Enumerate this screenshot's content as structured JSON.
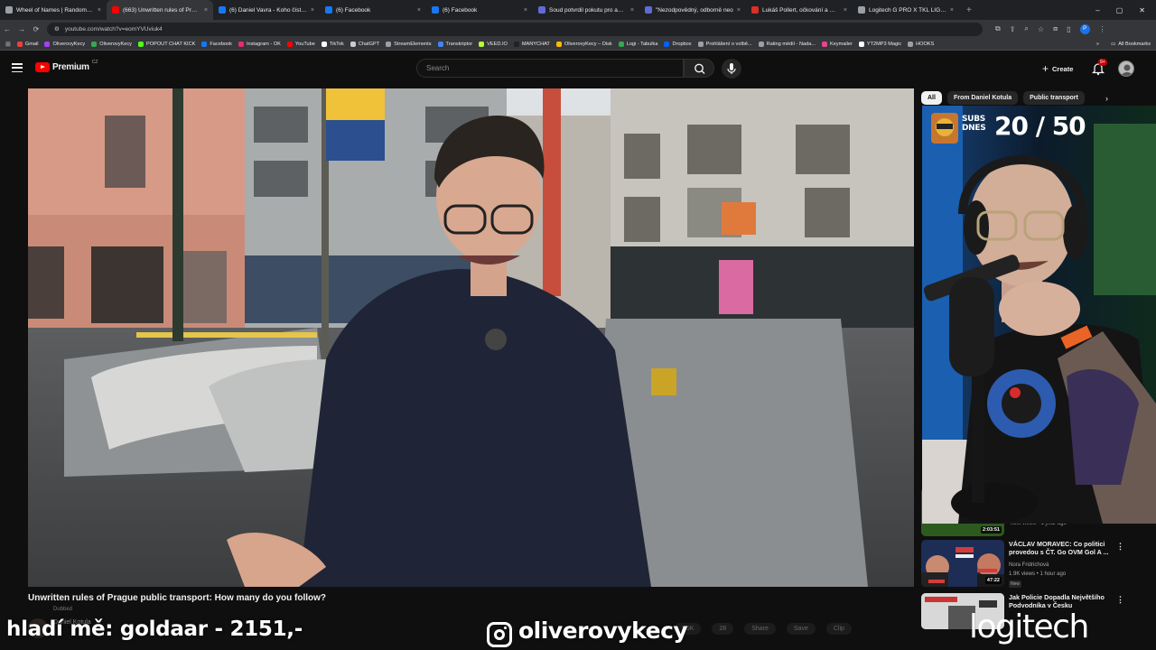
{
  "browser": {
    "tabs": [
      {
        "title": "Wheel of Names | Random nam",
        "color": "#9aa0a6"
      },
      {
        "title": "(663) Unwritten rules of Prague",
        "color": "#ff0000",
        "active": true
      },
      {
        "title": "(6) Daniel Vavra - Koho číst a s",
        "color": "#1877f2"
      },
      {
        "title": "(6) Facebook",
        "color": "#1877f2"
      },
      {
        "title": "(6) Facebook",
        "color": "#1877f2"
      },
      {
        "title": "Soud potvrdil pokutu pro advo",
        "color": "#5f6bd6"
      },
      {
        "title": "\"Nezodpovědný, odborně neo",
        "color": "#5f6bd6"
      },
      {
        "title": "Lukáš Pollert, očkování a muta",
        "color": "#d93025"
      },
      {
        "title": "Logitech G PRO X TKL LIGHTSP",
        "color": "#9aa0a6"
      }
    ],
    "tab_close": "×",
    "new_tab": "+",
    "url": "youtube.com/watch?v=eomYVUviuk4",
    "window_controls": [
      "–",
      "▢",
      "✕"
    ],
    "profile_letter": "P",
    "bookmarks": [
      {
        "label": "Gmail",
        "color": "#ea4335"
      },
      {
        "label": "OliverovyKecy",
        "color": "#a142f4"
      },
      {
        "label": "OliverovyKecy",
        "color": "#34a853"
      },
      {
        "label": "POPOUT CHAT KICK",
        "color": "#53fc18"
      },
      {
        "label": "Facebook",
        "color": "#1877f2"
      },
      {
        "label": "Instagram - OK",
        "color": "#e1306c"
      },
      {
        "label": "YouTube",
        "color": "#ff0000"
      },
      {
        "label": "TikTok",
        "color": "#ffffff"
      },
      {
        "label": "ChatGPT",
        "color": "#cccccc"
      },
      {
        "label": "StreamElements",
        "color": "#9aa0a6"
      },
      {
        "label": "Transkriptor",
        "color": "#4285f4"
      },
      {
        "label": "VEED.IO",
        "color": "#b0ff3a"
      },
      {
        "label": "MANYCHAT",
        "color": "#222222"
      },
      {
        "label": "OliverovyKecy – Disk",
        "color": "#fbbc04"
      },
      {
        "label": "Logi - Tabulka",
        "color": "#34a853"
      },
      {
        "label": "Dropbox",
        "color": "#0061ff"
      },
      {
        "label": "Prohlášení o volbě...",
        "color": "#9aa0a6"
      },
      {
        "label": "Rating médií - Nada...",
        "color": "#9aa0a6"
      },
      {
        "label": "Keymailer",
        "color": "#e8458b"
      },
      {
        "label": "YT2MP3 Magic",
        "color": "#ffffff"
      },
      {
        "label": "HOOKS",
        "color": "#9aa0a6"
      }
    ],
    "bookmarks_overflow": "»",
    "all_bookmarks": "All Bookmarks"
  },
  "youtube": {
    "brand": "Premium",
    "country": "CZ",
    "search_placeholder": "Search",
    "create_label": "Create",
    "notification_count": "9+",
    "video": {
      "title": "Unwritten rules of Prague public transport: How many do you follow?",
      "subtitle": "Dubbed",
      "channel": "Daniel Kotula",
      "actions": [
        "1.5K",
        "28",
        "Share",
        "Save",
        "Clip"
      ]
    },
    "chips": [
      "All",
      "From Daniel Kotula",
      "Public transport"
    ],
    "recommendations": [
      {
        "title": "",
        "views": "4.8M views • 1 year ago",
        "duration": "2:03:51"
      },
      {
        "title": "VÁCLAV MORAVEC: Co politici provedou s ČT. Go OVM Gol A ...",
        "channel": "Nora Fridrichová",
        "views": "1.9K views • 1 hour ago",
        "badge": "New",
        "duration": "47:22"
      },
      {
        "title": "Jak Policie Dopadla Největšího Podvodníka v Česku",
        "duration": ""
      }
    ]
  },
  "stream_overlay": {
    "subs_label_line1": "SUBS",
    "subs_label_line2": "DNES",
    "subs_count": "20 / 50",
    "donation_text": "hladí mě: goldaar - 2151,-",
    "instagram_handle": "oliverovykecy",
    "sponsor": "logitech"
  }
}
